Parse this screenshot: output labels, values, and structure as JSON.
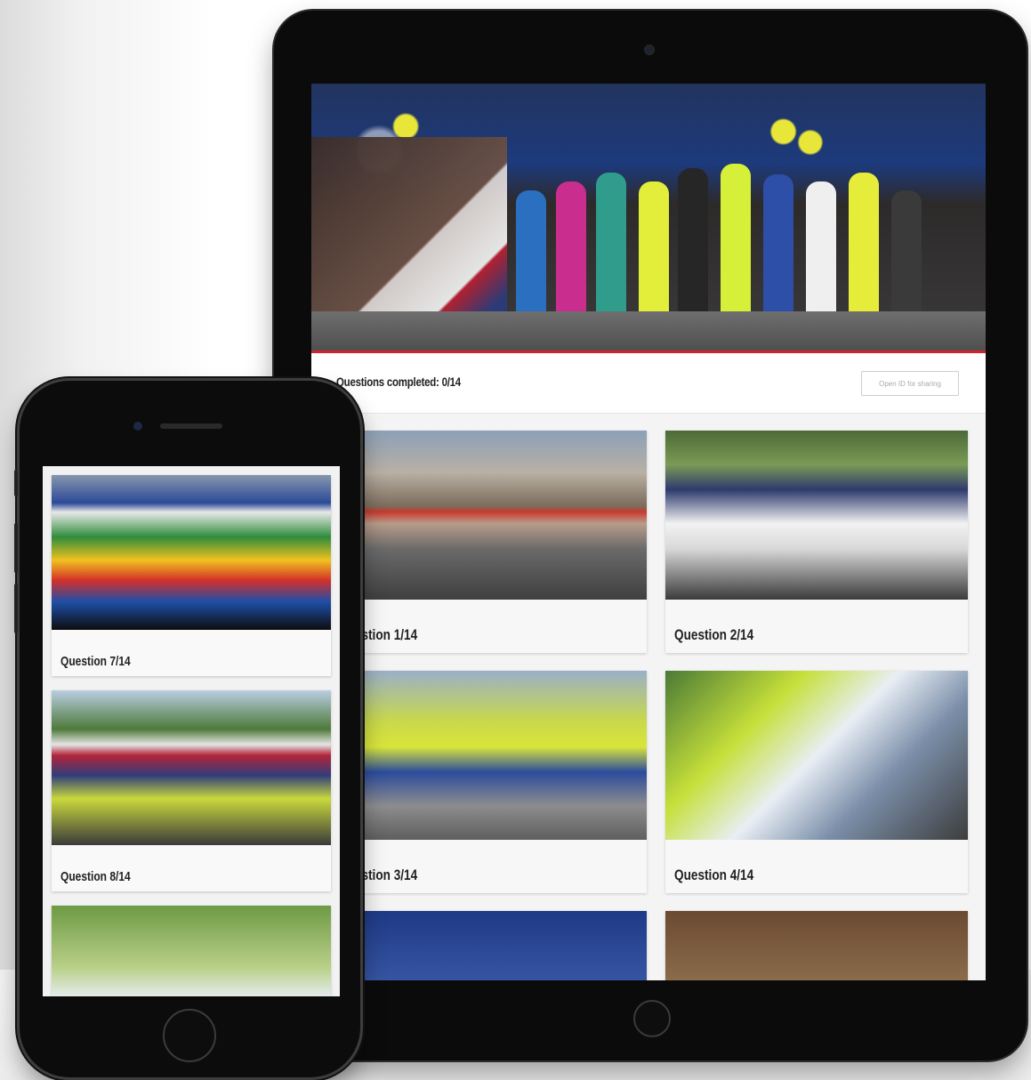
{
  "tablet": {
    "progress_label": "Questions completed: 0/14",
    "action_button": "Open ID for sharing",
    "cards": [
      {
        "label": "Question 1/14"
      },
      {
        "label": "Question 2/14"
      },
      {
        "label": "Question 3/14"
      },
      {
        "label": "Question 4/14"
      },
      {
        "label": ""
      },
      {
        "label": ""
      }
    ]
  },
  "phone": {
    "cards": [
      {
        "label": "Question 7/14"
      },
      {
        "label": "Question 8/14"
      },
      {
        "label": ""
      }
    ]
  },
  "colors": {
    "accent": "#d4222d",
    "background": "#f4f4f4",
    "card": "#f7f7f7",
    "text": "#222222"
  }
}
